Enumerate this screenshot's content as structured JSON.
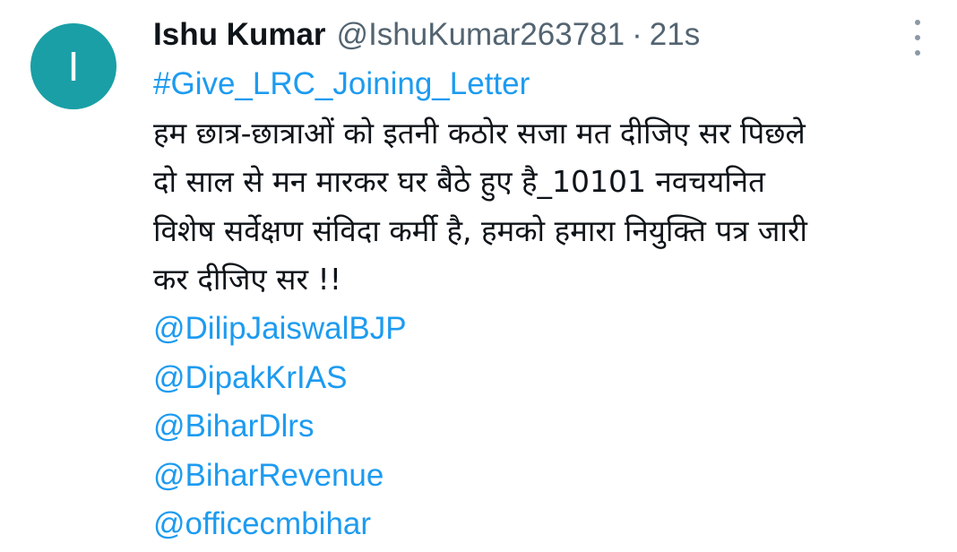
{
  "tweet": {
    "avatar_letter": "I",
    "name": "Ishu Kumar",
    "handle": "@IshuKumar263781",
    "separator": "·",
    "time": "21s",
    "more_icon": "more-vertical-icon",
    "hashtag": "#Give_LRC_Joining_Letter",
    "text_lines": [
      "हम छात्र-छात्राओं को इतनी कठोर सजा मत दीजिए सर पिछले",
      "दो साल से मन मारकर घर बैठे हुए है_10101 नवचयनित",
      "विशेष सर्वेक्षण संविदा कर्मी है, हमको हमारा नियुक्ति पत्र जारी",
      "कर दीजिए सर !!"
    ],
    "mentions": [
      "@DilipJaiswalBJP",
      "@DipakKrIAS",
      "@BiharDlrs",
      "@BiharRevenue",
      "@officecmbihar"
    ]
  },
  "colors": {
    "avatar_bg": "#1a9fa6",
    "link": "#1d9bf0",
    "secondary_text": "#536471",
    "primary_text": "#0f1419"
  }
}
